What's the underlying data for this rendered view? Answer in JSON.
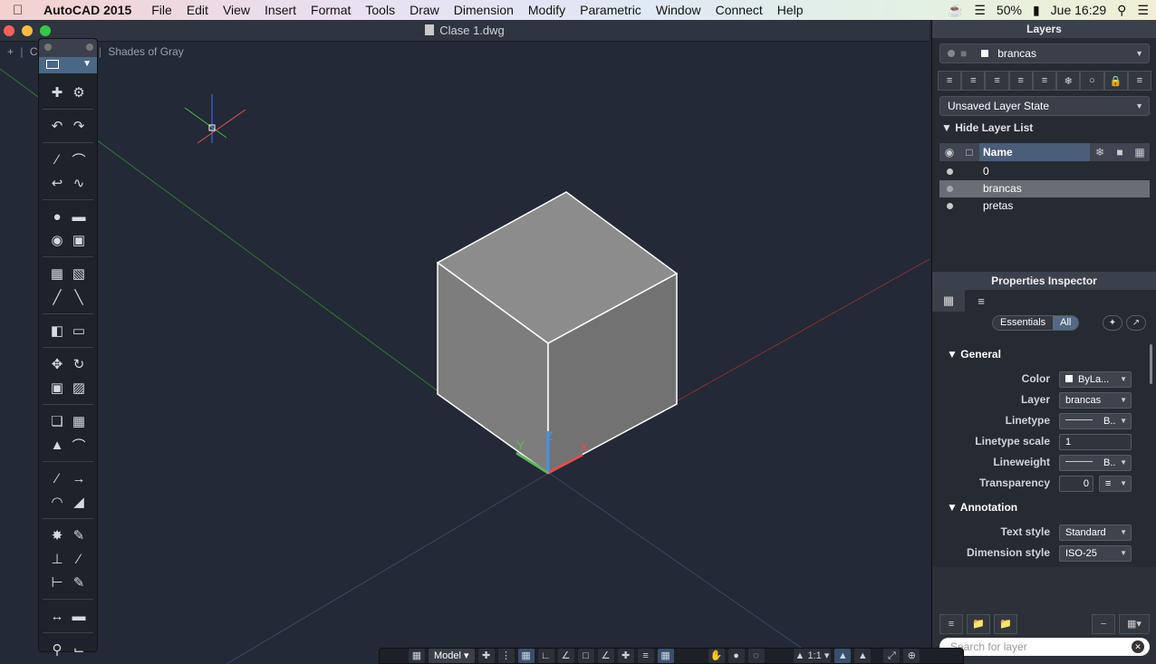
{
  "menubar": {
    "app_name": "AutoCAD 2015",
    "menus": [
      "File",
      "Edit",
      "View",
      "Insert",
      "Format",
      "Tools",
      "Draw",
      "Dimension",
      "Modify",
      "Parametric",
      "Window",
      "Connect",
      "Help"
    ],
    "battery": "50%",
    "clock": "Jue 16:29"
  },
  "window": {
    "title": "Clase 1.dwg"
  },
  "viewport": {
    "label_prefix": "+",
    "label_fragment": "C",
    "visual_style": "Shades of Gray"
  },
  "layers_panel": {
    "title": "Layers",
    "current_layer": "brancas",
    "layer_state": "Unsaved Layer State",
    "hide_list_label": "Hide Layer List",
    "column_name": "Name",
    "layers": [
      {
        "name": "0",
        "selected": false
      },
      {
        "name": "brancas",
        "selected": true
      },
      {
        "name": "pretas",
        "selected": false
      }
    ],
    "search_placeholder": "Search for layer"
  },
  "properties": {
    "title": "Properties Inspector",
    "filter_options": [
      "Essentials",
      "All"
    ],
    "active_filter": "All",
    "sections": {
      "general": "General",
      "annotation": "Annotation"
    },
    "general_rows": [
      {
        "label": "Color",
        "value": "ByLa..."
      },
      {
        "label": "Layer",
        "value": "brancas"
      },
      {
        "label": "Linetype",
        "value": "B.."
      },
      {
        "label": "Linetype scale",
        "value": "1"
      },
      {
        "label": "Lineweight",
        "value": "B.."
      },
      {
        "label": "Transparency",
        "value": "0"
      }
    ],
    "annotation_rows": [
      {
        "label": "Text style",
        "value": "Standard"
      },
      {
        "label": "Dimension style",
        "value": "ISO-25"
      }
    ]
  },
  "statusbar": {
    "space": "Model",
    "scale": "1:1"
  },
  "colors": {
    "background": "#222834",
    "cube_top": "#8a8a8a",
    "cube_left": "#7a7a7a",
    "cube_right": "#707070",
    "axis_x": "#d9534f",
    "axis_y": "#5cb85c",
    "axis_z": "#4a90e2"
  }
}
